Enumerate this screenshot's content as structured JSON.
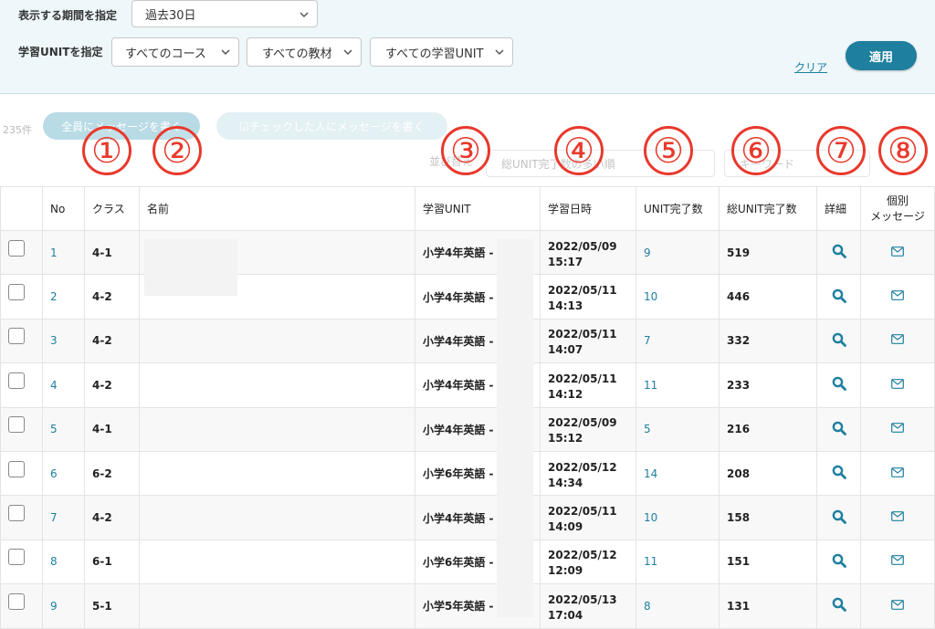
{
  "filters": {
    "period_label": "表示する期間を指定",
    "period_value": "過去30日",
    "unit_label": "学習UNITを指定",
    "course_value": "すべてのコース",
    "material_value": "すべての教材",
    "unit_value": "すべての学習UNIT",
    "clear_label": "クリア",
    "apply_label": "適用"
  },
  "toolbar": {
    "count_text": "235件",
    "message_all_label": "全員にメッセージを書く",
    "message_checked_label": "☑チェックした人にメッセージを書く",
    "sort_label": "並び替え",
    "sort_value": "総UNIT完了数の多い順",
    "keyword_placeholder": "キーワード"
  },
  "annotations": [
    "①",
    "②",
    "③",
    "④",
    "⑤",
    "⑥",
    "⑦",
    "⑧"
  ],
  "table": {
    "headers": {
      "no": "No",
      "class": "クラス",
      "name": "名前",
      "unit": "学習UNIT",
      "date": "学習日時",
      "unit_done": "UNIT完了数",
      "total_done": "総UNIT完了数",
      "detail": "詳細",
      "message_line1": "個別",
      "message_line2": "メッセージ"
    },
    "rows": [
      {
        "no": "1",
        "class": "4-1",
        "unit": "小学4年英語 -",
        "date": "2022/05/09",
        "time": "15:17",
        "unit_done": "9",
        "total_done": "519"
      },
      {
        "no": "2",
        "class": "4-2",
        "unit": "小学4年英語 -",
        "date": "2022/05/11",
        "time": "14:13",
        "unit_done": "10",
        "total_done": "446"
      },
      {
        "no": "3",
        "class": "4-2",
        "unit": "小学4年英語 -",
        "date": "2022/05/11",
        "time": "14:07",
        "unit_done": "7",
        "total_done": "332"
      },
      {
        "no": "4",
        "class": "4-2",
        "unit": "小学4年英語 -",
        "date": "2022/05/11",
        "time": "14:12",
        "unit_done": "11",
        "total_done": "233"
      },
      {
        "no": "5",
        "class": "4-1",
        "unit": "小学4年英語 -",
        "date": "2022/05/09",
        "time": "15:12",
        "unit_done": "5",
        "total_done": "216"
      },
      {
        "no": "6",
        "class": "6-2",
        "unit": "小学6年英語 -",
        "date": "2022/05/12",
        "time": "14:34",
        "unit_done": "14",
        "total_done": "208"
      },
      {
        "no": "7",
        "class": "4-2",
        "unit": "小学4年英語 -",
        "date": "2022/05/11",
        "time": "14:09",
        "unit_done": "10",
        "total_done": "158"
      },
      {
        "no": "8",
        "class": "6-1",
        "unit": "小学6年英語 -",
        "date": "2022/05/12",
        "time": "12:09",
        "unit_done": "11",
        "total_done": "151"
      },
      {
        "no": "9",
        "class": "5-1",
        "unit": "小学5年英語 -",
        "date": "2022/05/13",
        "time": "17:04",
        "unit_done": "8",
        "total_done": "131"
      }
    ]
  },
  "colors": {
    "accent": "#1e7f9f",
    "annotation": "#e8392c"
  }
}
